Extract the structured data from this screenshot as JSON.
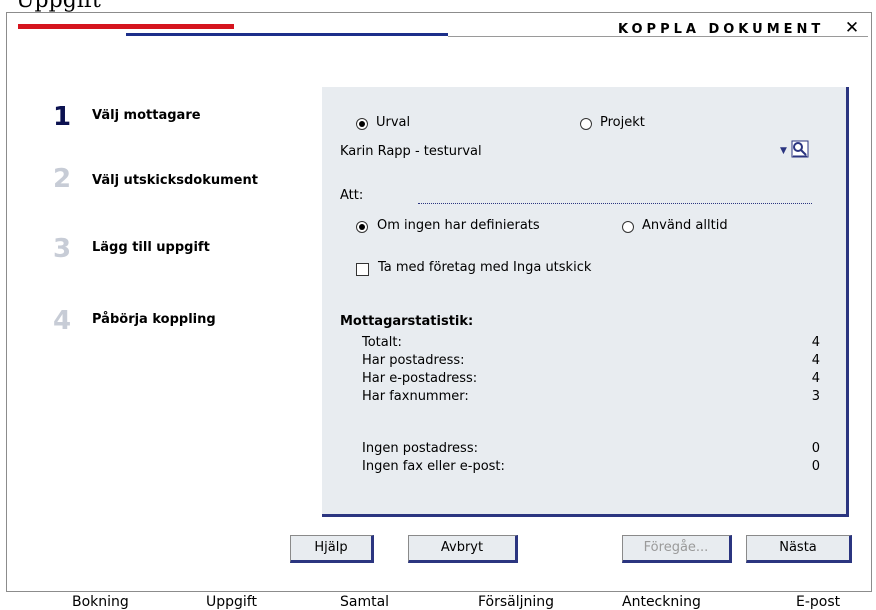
{
  "top_fragment": "Uppgift",
  "dialog": {
    "title": "KOPPLA DOKUMENT",
    "close_glyph": "✕"
  },
  "steps": [
    {
      "number": "1",
      "label": "Välj mottagare"
    },
    {
      "number": "2",
      "label": "Välj utskicksdokument"
    },
    {
      "number": "3",
      "label": "Lägg till uppgift"
    },
    {
      "number": "4",
      "label": "Påbörja koppling"
    }
  ],
  "selection": {
    "option_urval": "Urval",
    "option_projekt": "Projekt",
    "selected_value": "Karin Rapp - testurval",
    "att_label": "Att:",
    "option_om_ingen": "Om ingen har definierats",
    "option_anvand_alltid": "Använd alltid",
    "checkbox_label": "Ta med företag med Inga utskick"
  },
  "stats": {
    "heading": "Mottagarstatistik:",
    "rows": [
      {
        "label": "Totalt:",
        "value": "4"
      },
      {
        "label": "Har postadress:",
        "value": "4"
      },
      {
        "label": "Har e-postadress:",
        "value": "4"
      },
      {
        "label": "Har faxnummer:",
        "value": "3"
      }
    ],
    "rows2": [
      {
        "label": "Ingen postadress:",
        "value": "0"
      },
      {
        "label": "Ingen fax eller e-post:",
        "value": "0"
      }
    ]
  },
  "buttons": {
    "help": "Hjälp",
    "cancel": "Avbryt",
    "previous": "Föregåe...",
    "next": "Nästa"
  },
  "bottom_tabs": [
    "Bokning",
    "Uppgift",
    "Samtal",
    "Försäljning",
    "Anteckning",
    "E-post"
  ]
}
